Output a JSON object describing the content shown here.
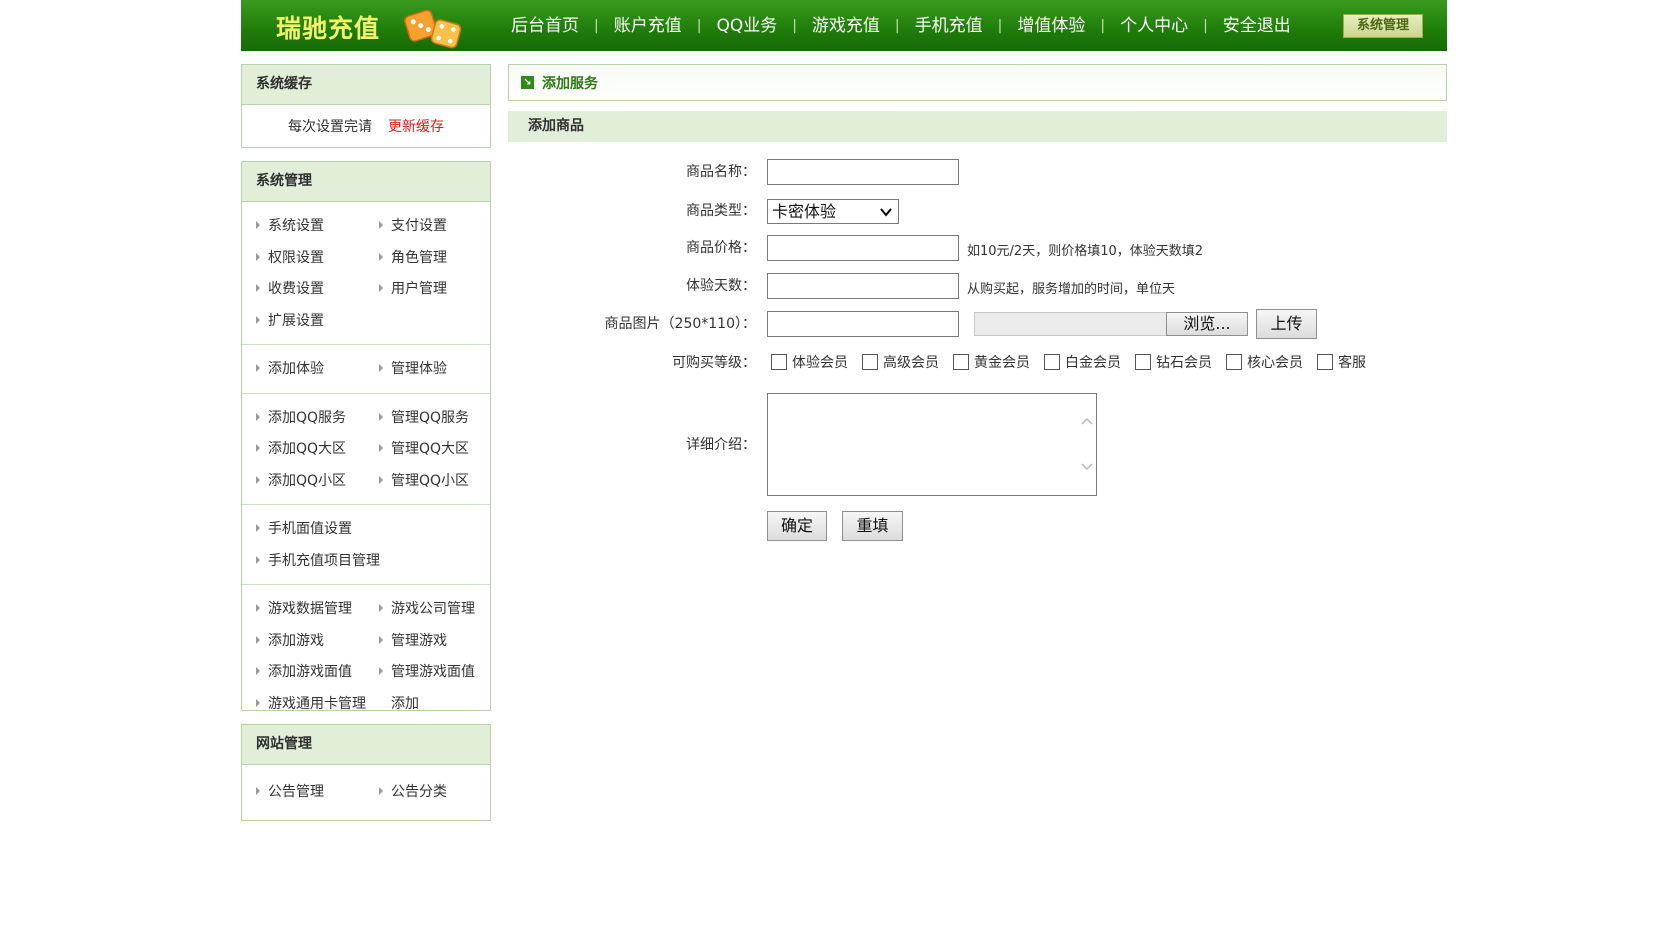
{
  "header": {
    "logo": "瑞驰充值",
    "nav": [
      "后台首页",
      "账户充值",
      "QQ业务",
      "游戏充值",
      "手机充值",
      "增值体验",
      "个人中心",
      "安全退出"
    ],
    "separator": "|",
    "system_button": "系统管理"
  },
  "sidebar": {
    "cache": {
      "title": "系统缓存",
      "text": "每次设置完请",
      "link": "更新缓存"
    },
    "system": {
      "title": "系统管理",
      "groups": [
        [
          "系统设置",
          "支付设置",
          "权限设置",
          "角色管理",
          "收费设置",
          "用户管理",
          "扩展设置"
        ],
        [
          "添加体验",
          "管理体验"
        ],
        [
          "添加QQ服务",
          "管理QQ服务",
          "添加QQ大区",
          "管理QQ大区",
          "添加QQ小区",
          "管理QQ小区"
        ],
        [
          "手机面值设置",
          "手机充值项目管理"
        ],
        [
          "游戏数据管理",
          "游戏公司管理",
          "添加游戏",
          "管理游戏",
          "添加游戏面值",
          "管理游戏面值",
          "游戏通用卡管理",
          "添加"
        ]
      ]
    },
    "site": {
      "title": "网站管理",
      "items": [
        "公告管理",
        "公告分类"
      ]
    }
  },
  "main": {
    "service_title": "添加服务",
    "service_icon": "arrow-box-icon",
    "section_title": "添加商品",
    "form": {
      "name_label": "商品名称：",
      "type_label": "商品类型：",
      "type_value": "卡密体验",
      "price_label": "商品价格：",
      "price_hint": "如10元/2天，则价格填10，体验天数填2",
      "days_label": "体验天数：",
      "days_hint": "从购买起，服务增加的时间，单位天",
      "image_label": "商品图片（250*110）：",
      "browse_button": "浏览...",
      "upload_button": "上传",
      "level_label": "可购买等级：",
      "levels": [
        "体验会员",
        "高级会员",
        "黄金会员",
        "白金会员",
        "钻石会员",
        "核心会员",
        "客服"
      ],
      "detail_label": "详细介绍：",
      "submit_button": "确定",
      "reset_button": "重填"
    }
  },
  "colors": {
    "header_green": "#1f7c0a",
    "logo_yellow": "#f3f26a",
    "panel_bg": "#e2efd8",
    "panel_border": "#b9d3a8",
    "link_red": "#d62020",
    "title_green": "#2c7a12"
  }
}
